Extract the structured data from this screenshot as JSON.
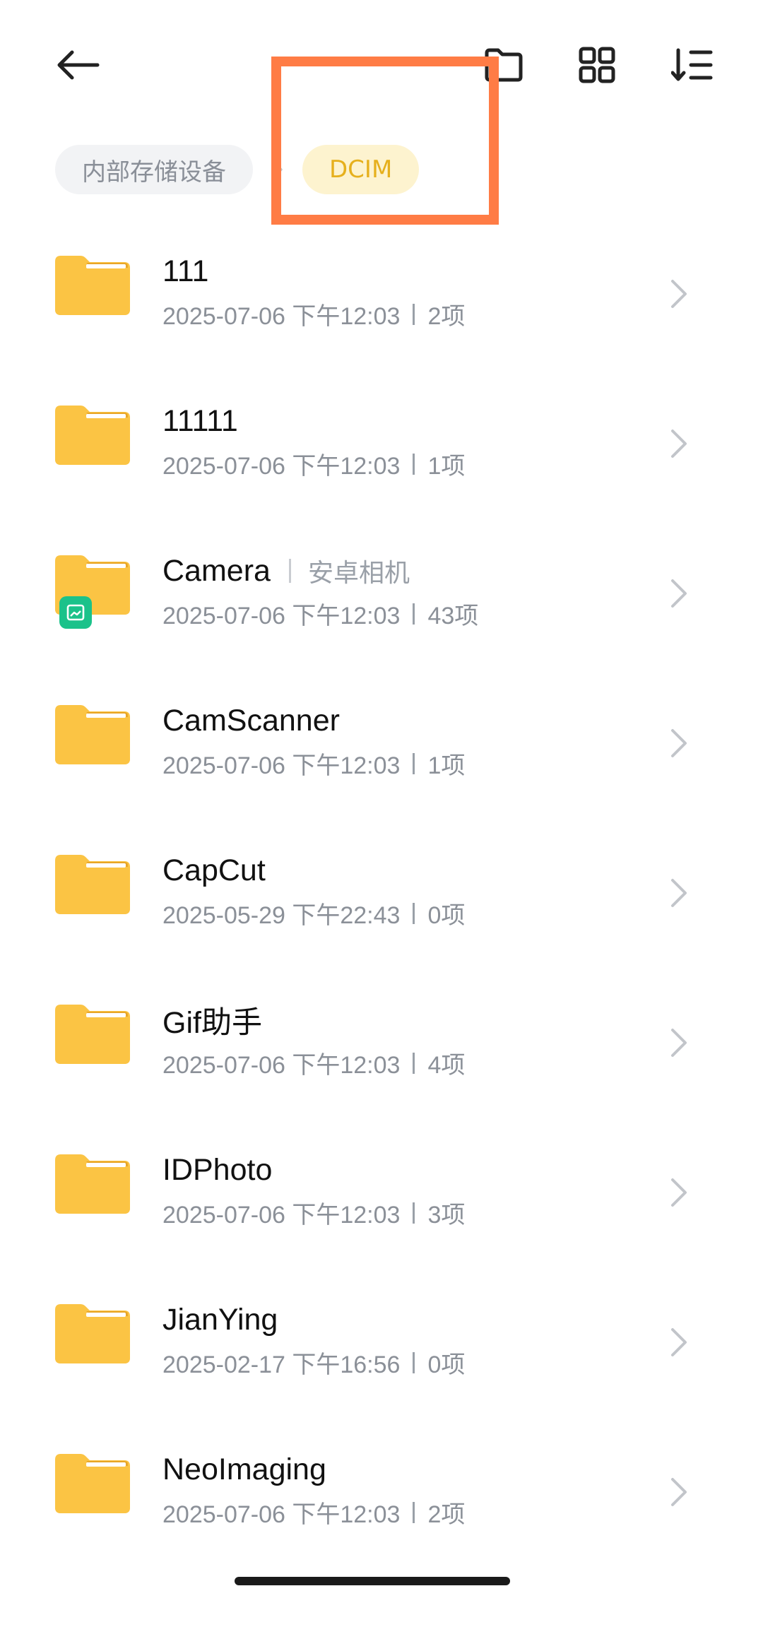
{
  "colors": {
    "folder": "#fbc444",
    "folder_tab": "#e8a628",
    "accent": "#e6b01d",
    "highlight": "#ff7c45",
    "badge": "#1bc28a"
  },
  "topbar": {
    "back_icon": "arrow-left-icon",
    "actions": [
      "new-folder-icon",
      "grid-view-icon",
      "sort-icon"
    ]
  },
  "breadcrumb": {
    "root": "内部存储设备",
    "separator_icon": "chevron-right-icon",
    "current": "DCIM"
  },
  "files": [
    {
      "name": "111",
      "alias": "",
      "date": "2025-07-06 下午12:03",
      "count": "2项",
      "badge": ""
    },
    {
      "name": "11111",
      "alias": "",
      "date": "2025-07-06 下午12:03",
      "count": "1项",
      "badge": ""
    },
    {
      "name": "Camera",
      "alias": "安卓相机",
      "date": "2025-07-06 下午12:03",
      "count": "43项",
      "badge": "image-icon"
    },
    {
      "name": "CamScanner",
      "alias": "",
      "date": "2025-07-06 下午12:03",
      "count": "1项",
      "badge": ""
    },
    {
      "name": "CapCut",
      "alias": "",
      "date": "2025-05-29 下午22:43",
      "count": "0项",
      "badge": ""
    },
    {
      "name": "Gif助手",
      "alias": "",
      "date": "2025-07-06 下午12:03",
      "count": "4项",
      "badge": ""
    },
    {
      "name": "IDPhoto",
      "alias": "",
      "date": "2025-07-06 下午12:03",
      "count": "3项",
      "badge": ""
    },
    {
      "name": "JianYing",
      "alias": "",
      "date": "2025-02-17 下午16:56",
      "count": "0项",
      "badge": ""
    },
    {
      "name": "NeoImaging",
      "alias": "",
      "date": "2025-07-06 下午12:03",
      "count": "2项",
      "badge": ""
    }
  ]
}
